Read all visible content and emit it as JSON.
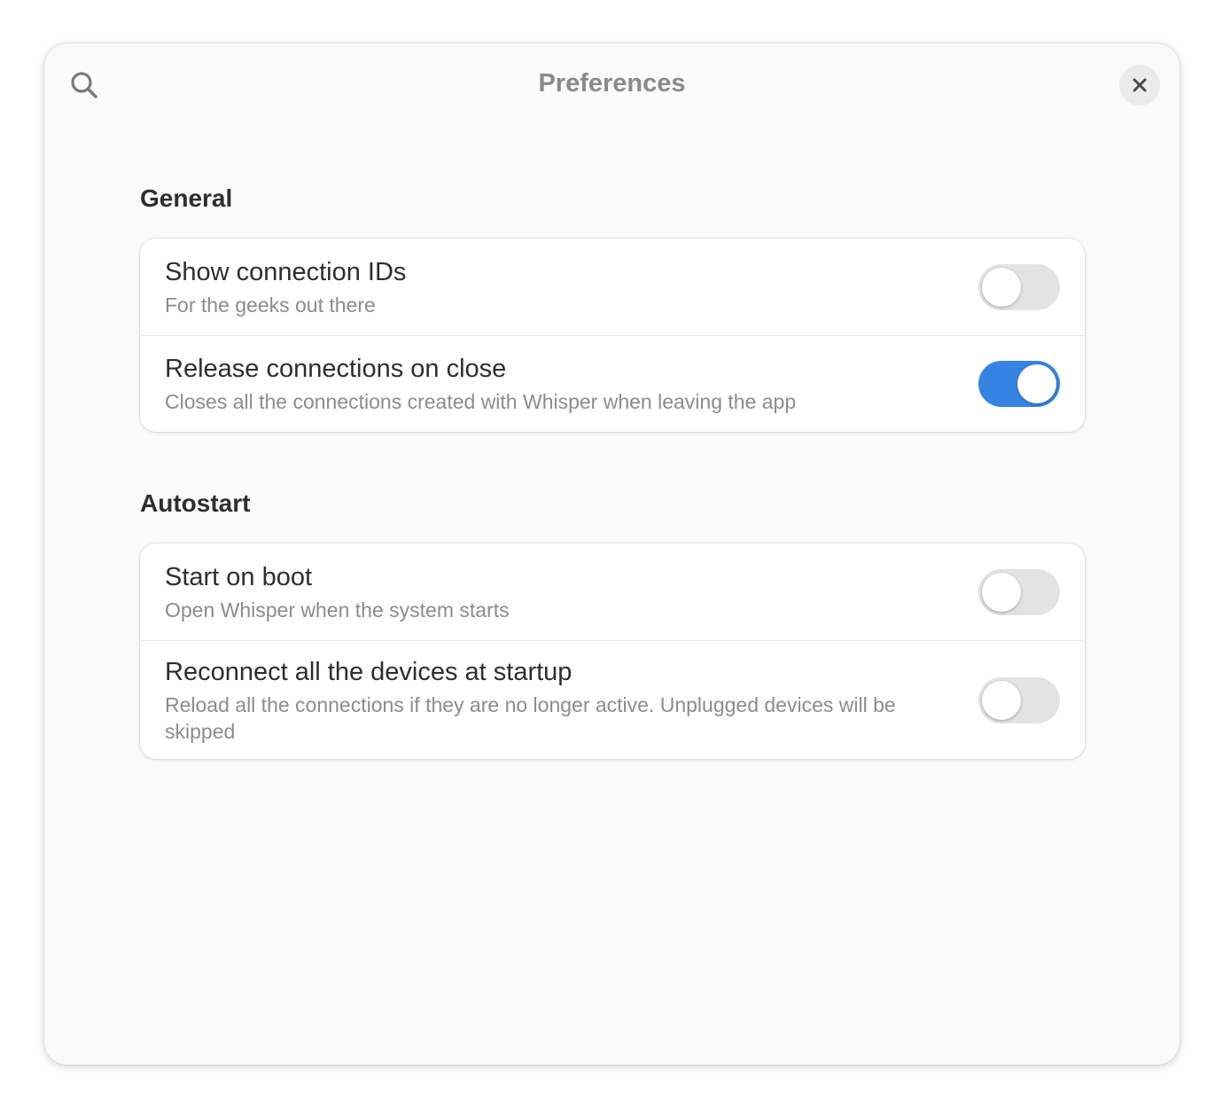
{
  "window": {
    "title": "Preferences",
    "search_icon": "search-icon",
    "close_icon": "close-icon"
  },
  "colors": {
    "accent": "#3584e4",
    "toggle_off": "#e3e3e3"
  },
  "groups": [
    {
      "title": "General",
      "rows": [
        {
          "title": "Show connection IDs",
          "subtitle": "For the geeks out there",
          "enabled": false
        },
        {
          "title": "Release connections on close",
          "subtitle": "Closes all the connections created with Whisper when leaving the app",
          "enabled": true
        }
      ]
    },
    {
      "title": "Autostart",
      "rows": [
        {
          "title": "Start on boot",
          "subtitle": "Open Whisper when the system starts",
          "enabled": false
        },
        {
          "title": "Reconnect all the devices at startup",
          "subtitle": "Reload all the connections if they are no longer active. Unplugged devices will be skipped",
          "enabled": false
        }
      ]
    }
  ]
}
